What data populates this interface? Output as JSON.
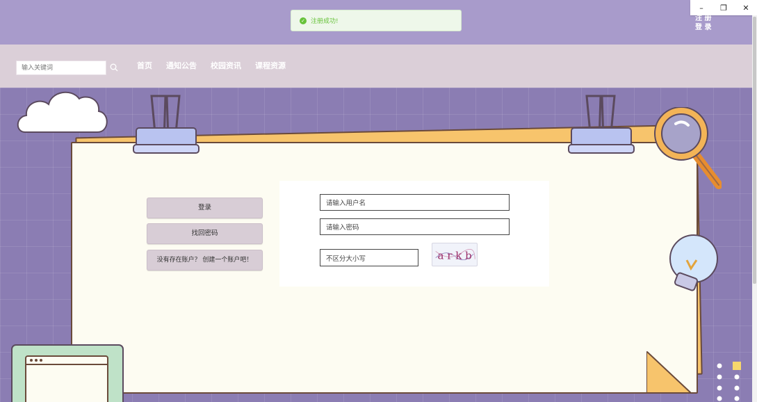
{
  "window_controls": {
    "minimize": "–",
    "restore": "❐",
    "close": "✕"
  },
  "toast": {
    "message": "注册成功!"
  },
  "header": {
    "register_label": "注 册",
    "login_label": "登 录"
  },
  "search": {
    "placeholder": "输入关键词"
  },
  "nav": {
    "items": [
      "首页",
      "通知公告",
      "校园资讯",
      "课程资源"
    ]
  },
  "side_buttons": {
    "login": "登录",
    "find_password": "找回密码",
    "create_account": "没有存在账户？ 创建一个账户吧！"
  },
  "form": {
    "username_value": "请输入用户名",
    "password_value": "请输入密码",
    "captcha_value": "不区分大小写",
    "captcha_text": "a r k b"
  },
  "colors": {
    "header_bg": "#a89bcb",
    "nav_bg": "#dbcfd8",
    "background": "#8b7db3",
    "paper": "#fdfcf2",
    "toast_green": "#67c23a"
  },
  "icons": [
    "check-circle-icon",
    "search-icon",
    "paper-clip-icon",
    "magnifier-icon",
    "lightbulb-icon",
    "cloud-icon",
    "browser-window-icon"
  ]
}
